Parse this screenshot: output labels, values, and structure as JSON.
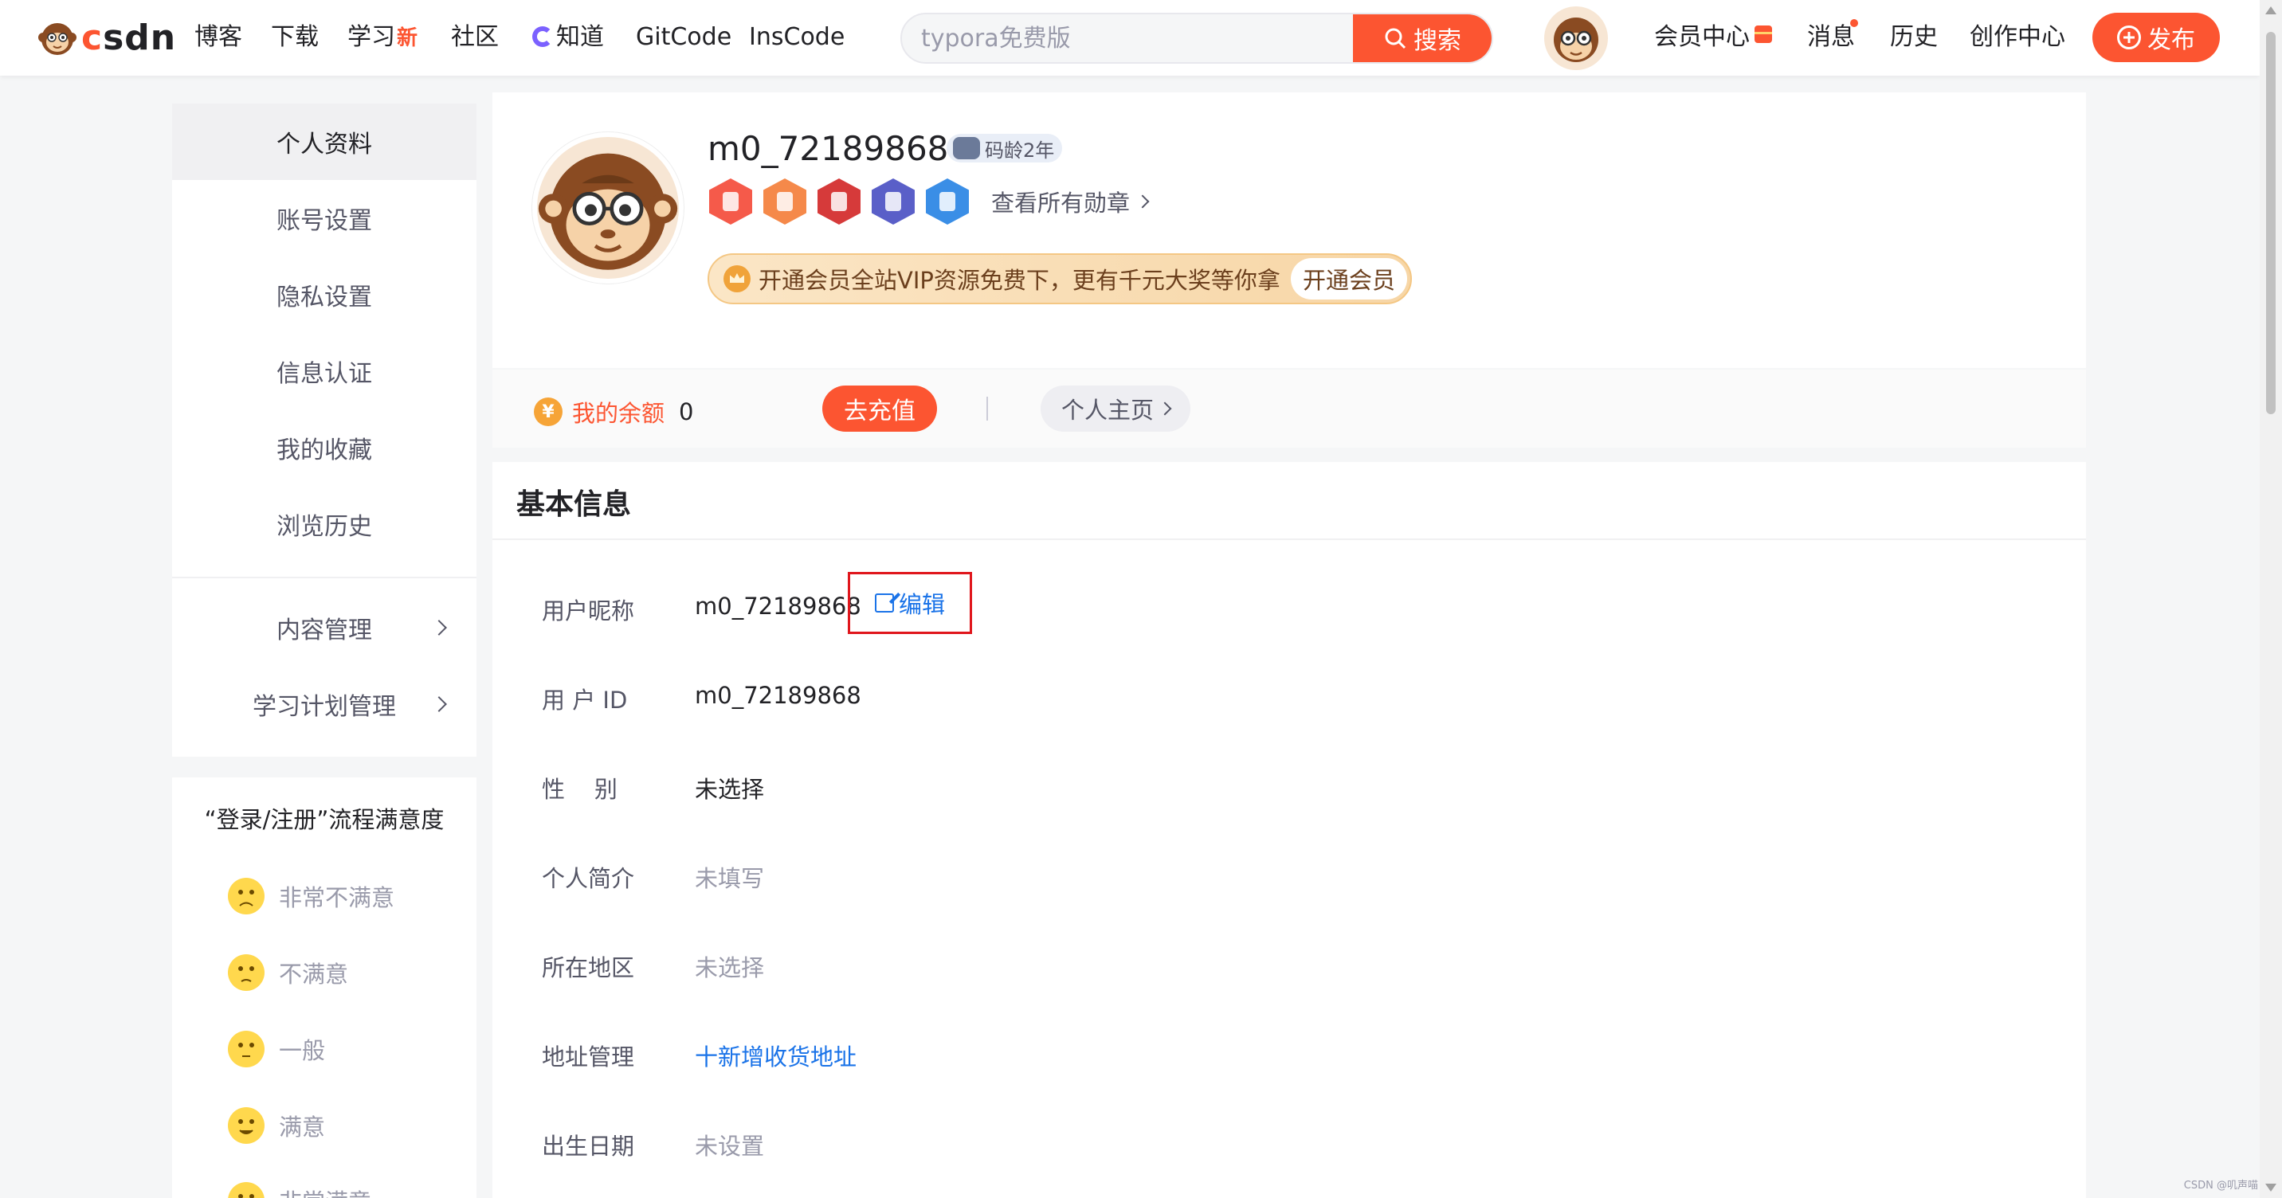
{
  "nav": {
    "logo_text": "csdn",
    "items": [
      "博客",
      "下载",
      "学习",
      "社区",
      "知道",
      "GitCode",
      "InsCode"
    ],
    "learn_new_tag": "新",
    "search_placeholder": "typora免费版",
    "search_button": "搜索",
    "member_center": "会员中心",
    "messages": "消息",
    "history": "历史",
    "creation_center": "创作中心",
    "publish": "发布"
  },
  "sidebar": {
    "items": [
      "个人资料",
      "账号设置",
      "隐私设置",
      "信息认证",
      "我的收藏",
      "浏览历史"
    ],
    "active_index": 0,
    "expandable": [
      "内容管理",
      "学习计划管理"
    ]
  },
  "survey": {
    "title": "“登录/注册”流程满意度",
    "options": [
      "非常不满意",
      "不满意",
      "一般",
      "满意",
      "非常满意"
    ]
  },
  "profile": {
    "username": "m0_72189868",
    "code_age": "码龄2年",
    "medals_link": "查看所有勋章",
    "medal_colors": [
      "#f55a4a",
      "#f5894a",
      "#d63a3a",
      "#5a5fc8",
      "#3a8ee6"
    ],
    "vip_text": "开通会员全站VIP资源免费下，更有千元大奖等你拿",
    "vip_button": "开通会员",
    "balance_label": "我的余额",
    "balance_value": "0",
    "recharge": "去充值",
    "homepage": "个人主页"
  },
  "basic_info": {
    "title": "基本信息",
    "rows": [
      {
        "label": "用户昵称",
        "value": "m0_72189868"
      },
      {
        "label": "用 户 ID",
        "value": "m0_72189868"
      },
      {
        "label": "性    别",
        "value": "未选择"
      },
      {
        "label": "个人简介",
        "value": "未填写"
      },
      {
        "label": "所在地区",
        "value": "未选择"
      },
      {
        "label": "地址管理",
        "value": "十新增收货地址"
      },
      {
        "label": "出生日期",
        "value": "未设置"
      }
    ],
    "edit_label": "编辑"
  },
  "watermark": "CSDN @叽声喵",
  "colors": {
    "brand": "#fc5531",
    "link": "#1a73e8",
    "highlight_box": "#e0161c"
  }
}
